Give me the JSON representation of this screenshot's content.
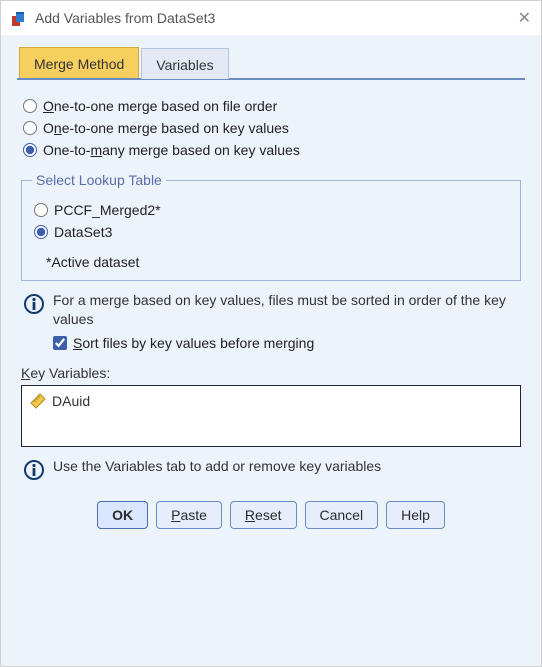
{
  "window": {
    "title": "Add Variables from DataSet3"
  },
  "tabs": {
    "merge_method": "Merge Method",
    "variables": "Variables"
  },
  "merge_options": {
    "opt1_pre": "O",
    "opt1_rest": "ne-to-one merge based on file order",
    "opt2_pre": "O",
    "opt2_u": "n",
    "opt2_rest": "e-to-one merge based on key values",
    "opt3_pre": "One-to-",
    "opt3_u": "m",
    "opt3_rest": "any merge based on key values"
  },
  "lookup": {
    "legend": "Select Lookup Table",
    "opt1": "PCCF_Merged2*",
    "opt2": "DataSet3",
    "active_note": "*Active dataset"
  },
  "info": {
    "sort_hint": "For a merge based on key values, files must be sorted in order of the key values",
    "sort_u": "S",
    "sort_rest": "ort files by key values before merging",
    "vars_hint": "Use the Variables tab to add or remove key variables"
  },
  "key_variables": {
    "label_u": "K",
    "label_rest": "ey Variables:",
    "items": [
      {
        "name": "DAuid"
      }
    ]
  },
  "buttons": {
    "ok": "OK",
    "paste_u": "P",
    "paste_rest": "aste",
    "reset_u": "R",
    "reset_rest": "eset",
    "cancel": "Cancel",
    "help": "Help"
  }
}
